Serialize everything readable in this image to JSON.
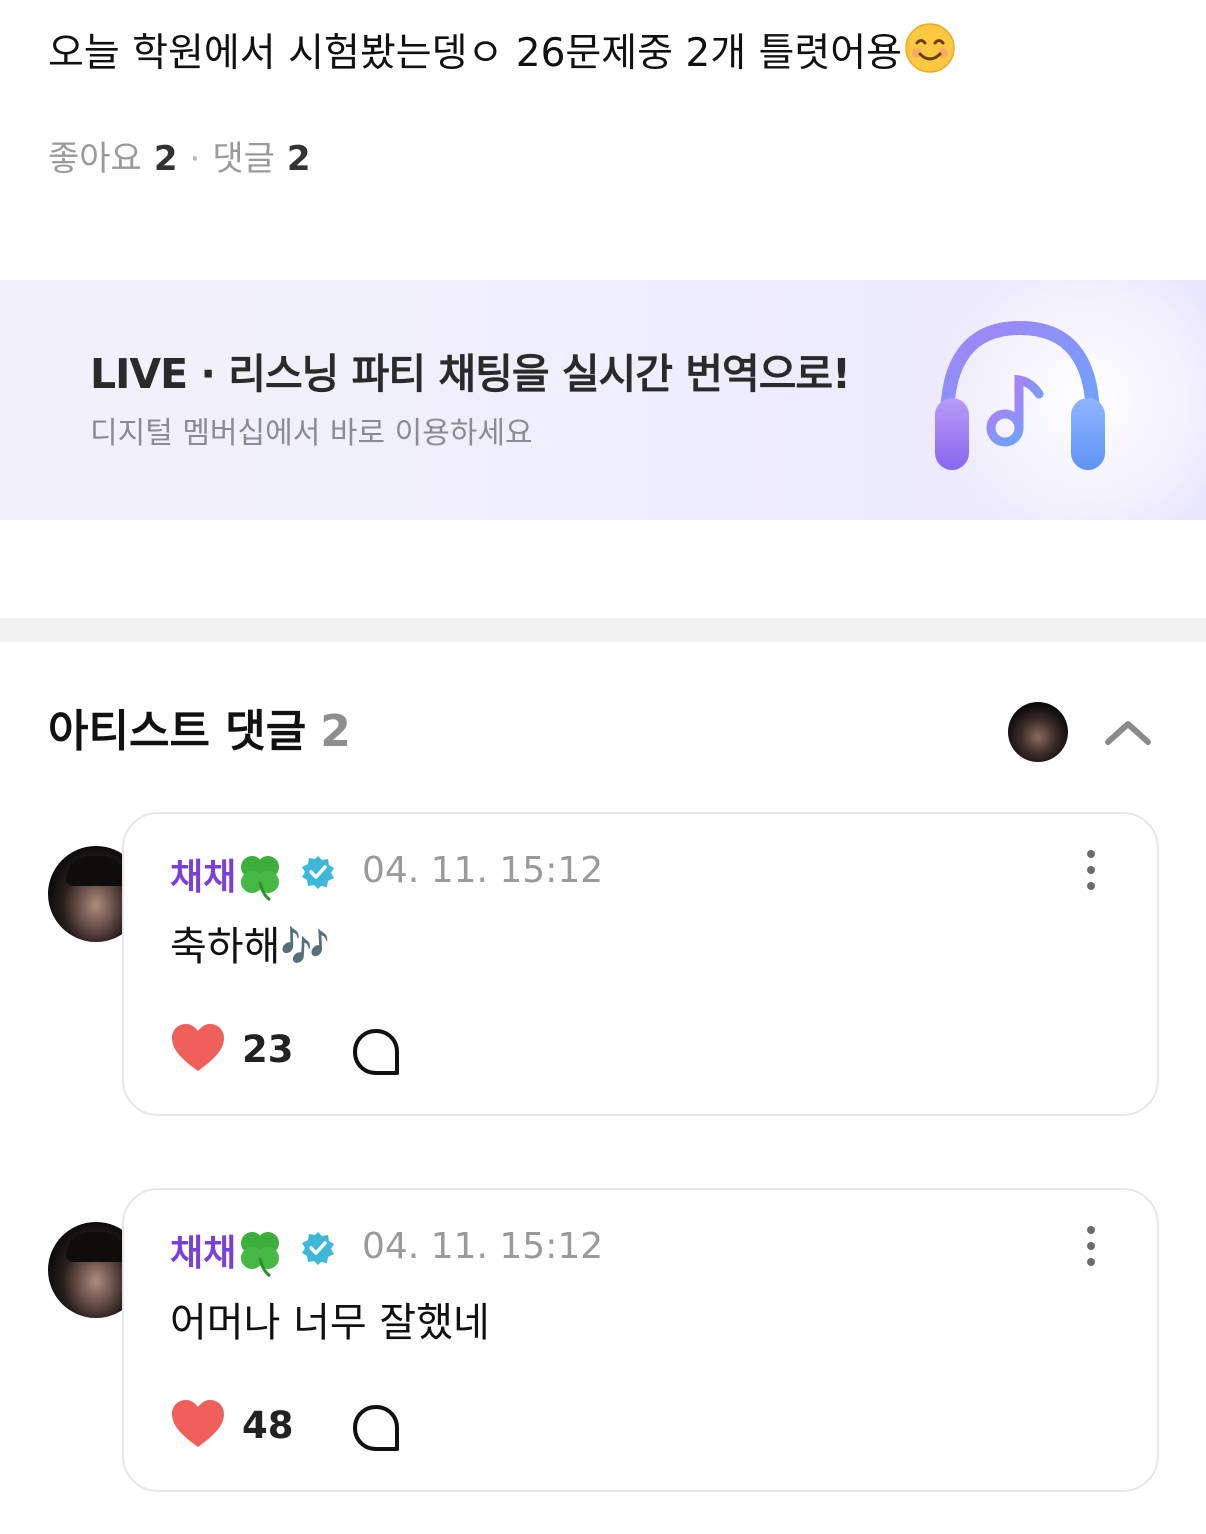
{
  "post": {
    "text": "오늘 학원에서 시험봤는뎅ㅇ 26문제중 2개 틀렷어용",
    "emoji": "smiling-face-icon",
    "likes_label": "좋아요",
    "likes_count": "2",
    "separator": "·",
    "comments_label": "댓글",
    "comments_count": "2"
  },
  "banner": {
    "title": "LIVE · 리스닝 파티 채팅을 실시간 번역으로!",
    "subtitle": "디지털 멤버십에서 바로 이용하세요",
    "icon": "headphones-music-icon",
    "accent_colors": [
      "#8f6cf0",
      "#6ea8ff"
    ]
  },
  "artist_comments": {
    "title": "아티스트 댓글",
    "count": "2",
    "collapse_icon": "chevron-up-icon",
    "items": [
      {
        "name": "채채",
        "name_icon": "four-leaf-clover-icon",
        "badge": "verified-badge-icon",
        "date": "04. 11. 15:12",
        "text": "축하해🎶",
        "likes": "23"
      },
      {
        "name": "채채",
        "name_icon": "four-leaf-clover-icon",
        "badge": "verified-badge-icon",
        "date": "04. 11. 15:12",
        "text": "어머나 너무 잘했네",
        "likes": "48"
      }
    ]
  },
  "colors": {
    "artist_name": "#7a3fd9",
    "verified": "#3db8d8",
    "heart": "#f0605a"
  }
}
